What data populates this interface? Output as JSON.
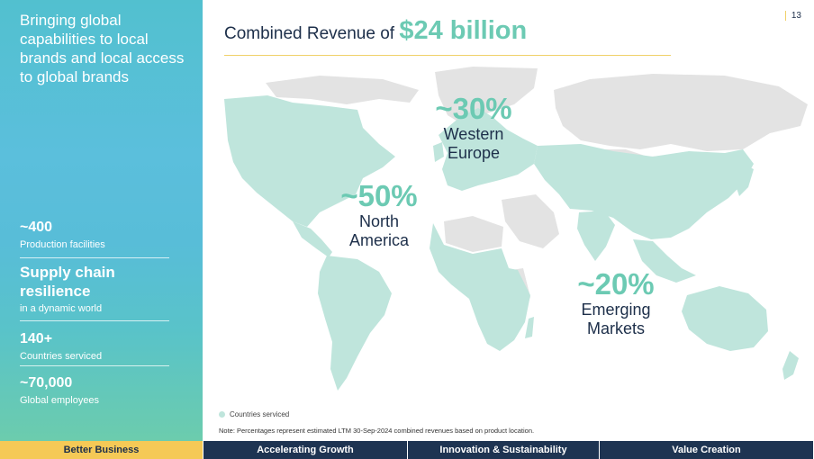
{
  "sidebar": {
    "tagline": "Bringing global capabilities to local brands and local access to global brands",
    "stats": [
      {
        "value": "~400",
        "label": "Production facilities"
      },
      {
        "value": "Supply chain resilience",
        "label": "in a dynamic world"
      },
      {
        "value": "140+",
        "label": "Countries serviced"
      },
      {
        "value": "~70,000",
        "label": "Global employees"
      }
    ]
  },
  "header": {
    "title_prefix": "Combined Revenue of",
    "title_highlight": "$24 billion",
    "page_number": "13"
  },
  "regions": [
    {
      "pct": "~30%",
      "name": "Western Europe"
    },
    {
      "pct": "~50%",
      "name": "North America"
    },
    {
      "pct": "~20%",
      "name": "Emerging Markets"
    }
  ],
  "legend": {
    "label": "Countries serviced"
  },
  "note": "Note: Percentages represent estimated LTM 30-Sep-2024 combined revenues based on product location.",
  "footer": {
    "tabs": [
      "Better Business",
      "Accelerating Growth",
      "Innovation & Sustainability",
      "Value Creation"
    ]
  },
  "colors": {
    "accent": "#6ccab3",
    "serviced": "#bfe5dc",
    "not_serviced": "#e3e3e3",
    "navy": "#1e3452",
    "gold": "#f5c956"
  }
}
